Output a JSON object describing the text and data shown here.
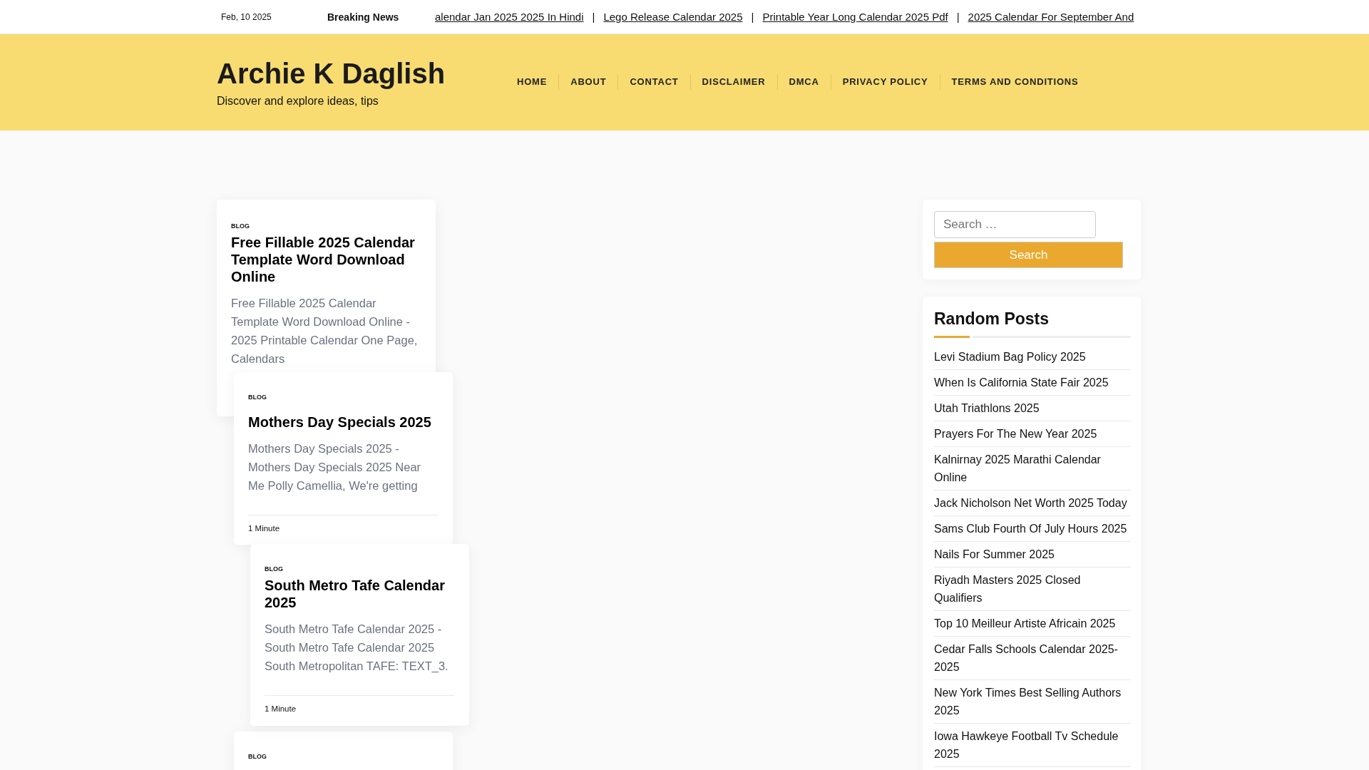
{
  "top_bar": {
    "date": "Feb, 10 2025",
    "ticker_label": "Breaking News",
    "ticker_items": [
      "alendar Jan 2025 2025 In Hindi",
      "Lego Release Calendar 2025",
      "Printable Year Long Calendar 2025 Pdf",
      "2025 Calendar For September And"
    ],
    "separator": "|"
  },
  "header": {
    "site_title": "Archie K Daglish",
    "tagline": "Discover and explore ideas, tips",
    "nav": [
      "HOME",
      "ABOUT",
      "CONTACT",
      "DISCLAIMER",
      "DMCA",
      "PRIVACY POLICY",
      "TERMS AND CONDITIONS"
    ]
  },
  "posts": [
    {
      "category": "BLOG",
      "title": "Free Fillable 2025 Calendar Template Word Download Online",
      "excerpt": "Free Fillable 2025 Calendar Template Word Download Online - 2025 Printable Calendar One Page, Calendars"
    },
    {
      "category": "BLOG",
      "title": "Mothers Day Specials 2025",
      "excerpt": "Mothers Day Specials 2025 - Mothers Day Specials 2025 Near Me Polly Camellia, We're getting",
      "meta": "1 Minute"
    },
    {
      "category": "BLOG",
      "title": "South Metro Tafe Calendar 2025",
      "excerpt": "South Metro Tafe Calendar 2025 - South Metro Tafe Calendar 2025 South Metropolitan TAFE: TEXT_3.",
      "meta": "1 Minute"
    },
    {
      "category": "BLOG"
    }
  ],
  "sidebar": {
    "search": {
      "placeholder": "Search …",
      "button": "Search"
    },
    "random_posts": {
      "heading": "Random Posts",
      "items": [
        "Levi Stadium Bag Policy 2025",
        "When Is California State Fair 2025",
        "Utah Triathlons 2025",
        "Prayers For The New Year 2025",
        "Kalnirnay 2025 Marathi Calendar Online",
        "Jack Nicholson Net Worth 2025 Today",
        "Sams Club Fourth Of July Hours 2025",
        "Nails For Summer 2025",
        "Riyadh Masters 2025 Closed Qualifiers",
        "Top 10 Meilleur Artiste Africain 2025",
        "Cedar Falls Schools Calendar 2025-2025",
        "New York Times Best Selling Authors 2025",
        "Iowa Hawkeye Football Tv Schedule 2025"
      ]
    }
  }
}
